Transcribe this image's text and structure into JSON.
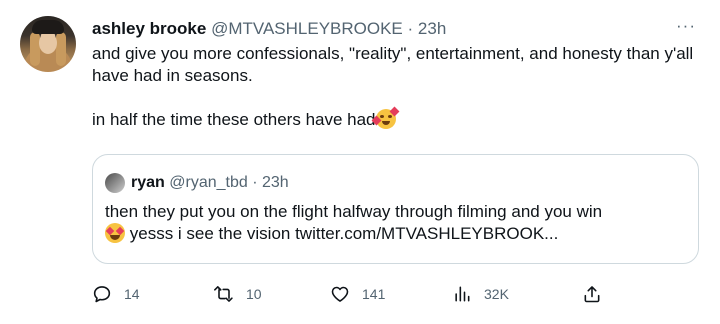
{
  "tweet": {
    "author": {
      "name": "ashley brooke",
      "handle": "@MTVASHLEYBROOKE",
      "separator": "·",
      "time": "23h"
    },
    "more_label": "···",
    "body": {
      "line1": "and give you more confessionals, \"reality\", entertainment, and honesty than y'all have had in seasons.",
      "line2": "in half the time these others have had"
    },
    "quote": {
      "name": "ryan",
      "handle": "@ryan_tbd",
      "separator": "·",
      "time": "23h",
      "text_line1": "then they put you on the flight halfway through filming and you win",
      "text_line2": "yesss i see the vision twitter.com/MTVASHLEYBROOK..."
    },
    "actions": {
      "replies": "14",
      "retweets": "10",
      "likes": "141",
      "views": "32K"
    },
    "icons": {
      "reply": "reply-icon",
      "retweet": "retweet-icon",
      "like": "heart-icon",
      "views": "views-chart-icon",
      "share": "share-icon",
      "emoji_body": "smiling-face-with-hearts-emoji",
      "emoji_quote": "heart-eyes-emoji"
    },
    "colors": {
      "text": "#0f1419",
      "secondary": "#536471",
      "border": "#cfd9de"
    }
  }
}
